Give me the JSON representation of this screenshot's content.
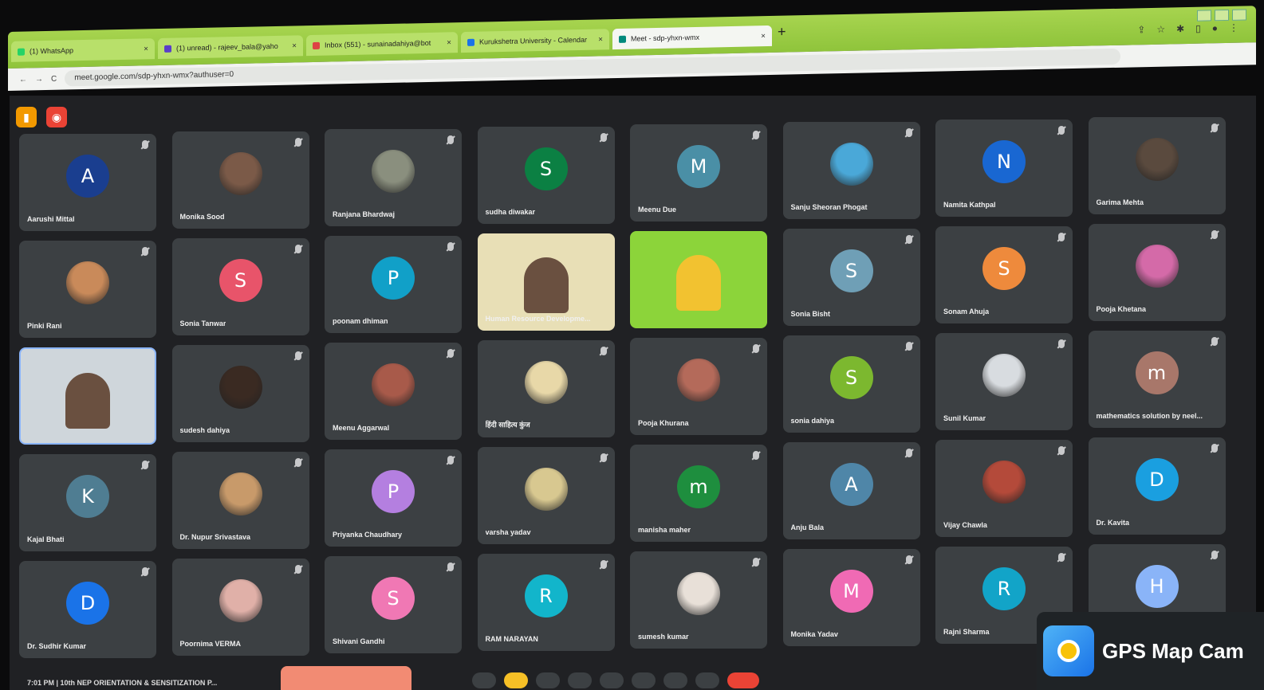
{
  "browser": {
    "tabs": [
      {
        "label": "(1) WhatsApp"
      },
      {
        "label": "(1) unread) - rajeev_bala@yaho"
      },
      {
        "label": "Inbox (551) - sunainadahiya@bot"
      },
      {
        "label": "Kurukshetra University - Calendar"
      },
      {
        "label": "Meet - sdp-yhxn-wmx"
      }
    ],
    "url": "meet.google.com/sdp-yhxn-wmx?authuser=0",
    "newtab_label": "+"
  },
  "meet": {
    "tiles": [
      {
        "name": "Aarushi Mittal",
        "initial": "A",
        "color": "#1a3e8f",
        "type": "initial"
      },
      {
        "name": "Monika Sood",
        "type": "photo",
        "color": "#7b5a48"
      },
      {
        "name": "Ranjana Bhardwaj",
        "type": "photo",
        "color": "#8a8f7e"
      },
      {
        "name": "sudha diwakar",
        "initial": "S",
        "color": "#0b8043",
        "type": "initial"
      },
      {
        "name": "Meenu Due",
        "initial": "M",
        "color": "#4a8fa6",
        "type": "initial"
      },
      {
        "name": "Sanju Sheoran Phogat",
        "type": "photo",
        "color": "#4aa8d8"
      },
      {
        "name": "Namita Kathpal",
        "initial": "N",
        "color": "#1967d2",
        "type": "initial"
      },
      {
        "name": "Garima Mehta",
        "type": "photo",
        "color": "#5a4a3e"
      },
      {
        "name": "Pinki Rani",
        "type": "photo",
        "color": "#c98a5a"
      },
      {
        "name": "Sonia Tanwar",
        "initial": "S",
        "color": "#e8546a",
        "type": "initial"
      },
      {
        "name": "poonam dhiman",
        "initial": "P",
        "color": "#11a0c8",
        "type": "initial"
      },
      {
        "name": "Human Resource Developme...",
        "type": "video",
        "color": "#e8dfb6"
      },
      {
        "name": "",
        "type": "video-green",
        "color": "#8cd43a"
      },
      {
        "name": "Sonia Bisht",
        "initial": "S",
        "color": "#6f9fb6",
        "type": "initial"
      },
      {
        "name": "Sonam Ahuja",
        "initial": "S",
        "color": "#ee8a3c",
        "type": "initial"
      },
      {
        "name": "Pooja Khetana",
        "type": "photo",
        "color": "#d46aa8"
      },
      {
        "name": "",
        "type": "video-self",
        "color": "#cfd6db"
      },
      {
        "name": "sudesh dahiya",
        "type": "photo",
        "color": "#3a2a22"
      },
      {
        "name": "Meenu Aggarwal",
        "type": "photo",
        "color": "#a85a4a"
      },
      {
        "name": "हिंदी साहित्य कुंज",
        "type": "photo",
        "color": "#e8d8a8"
      },
      {
        "name": "Pooja Khurana",
        "type": "photo",
        "color": "#b46a5a"
      },
      {
        "name": "sonia dahiya",
        "initial": "S",
        "color": "#7cb82f",
        "type": "initial"
      },
      {
        "name": "Sunil Kumar",
        "type": "photo",
        "color": "#d8dce0"
      },
      {
        "name": "mathematics solution by neel...",
        "initial": "m",
        "color": "#a8776a",
        "type": "initial"
      },
      {
        "name": "Kajal Bhati",
        "initial": "K",
        "color": "#4f7d92",
        "type": "initial"
      },
      {
        "name": "Dr. Nupur Srivastava",
        "type": "photo",
        "color": "#c89a6a"
      },
      {
        "name": "Priyanka Chaudhary",
        "initial": "P",
        "color": "#b47fe0",
        "type": "initial"
      },
      {
        "name": "varsha yadav",
        "type": "photo",
        "color": "#d8c890"
      },
      {
        "name": "manisha maher",
        "initial": "m",
        "color": "#1e8e3e",
        "type": "initial"
      },
      {
        "name": "Anju Bala",
        "initial": "A",
        "color": "#4f86a8",
        "type": "initial"
      },
      {
        "name": "Vijay Chawla",
        "type": "photo",
        "color": "#b44a3a"
      },
      {
        "name": "Dr. Kavita",
        "initial": "D",
        "color": "#1a9fe0",
        "type": "initial"
      },
      {
        "name": "Dr. Sudhir Kumar",
        "initial": "D",
        "color": "#1a73e8",
        "type": "initial"
      },
      {
        "name": "Poornima VERMA",
        "type": "photo",
        "color": "#e0b0a8"
      },
      {
        "name": "Shivani Gandhi",
        "initial": "S",
        "color": "#f078b4",
        "type": "initial"
      },
      {
        "name": "RAM NARAYAN",
        "initial": "R",
        "color": "#12b5cb",
        "type": "initial"
      },
      {
        "name": "sumesh kumar",
        "type": "photo",
        "color": "#e8e0d8"
      },
      {
        "name": "Monika Yadav",
        "initial": "M",
        "color": "#f06ab4",
        "type": "initial"
      },
      {
        "name": "Rajni Sharma",
        "initial": "R",
        "color": "#12a4c8",
        "type": "initial"
      },
      {
        "name": "",
        "initial": "H",
        "color": "#8ab4f8",
        "type": "initial"
      }
    ],
    "bottom_text": "7:01 PM  |  10th NEP ORIENTATION & SENSITIZATION P..."
  },
  "watermark": {
    "label": "GPS Map Cam"
  }
}
